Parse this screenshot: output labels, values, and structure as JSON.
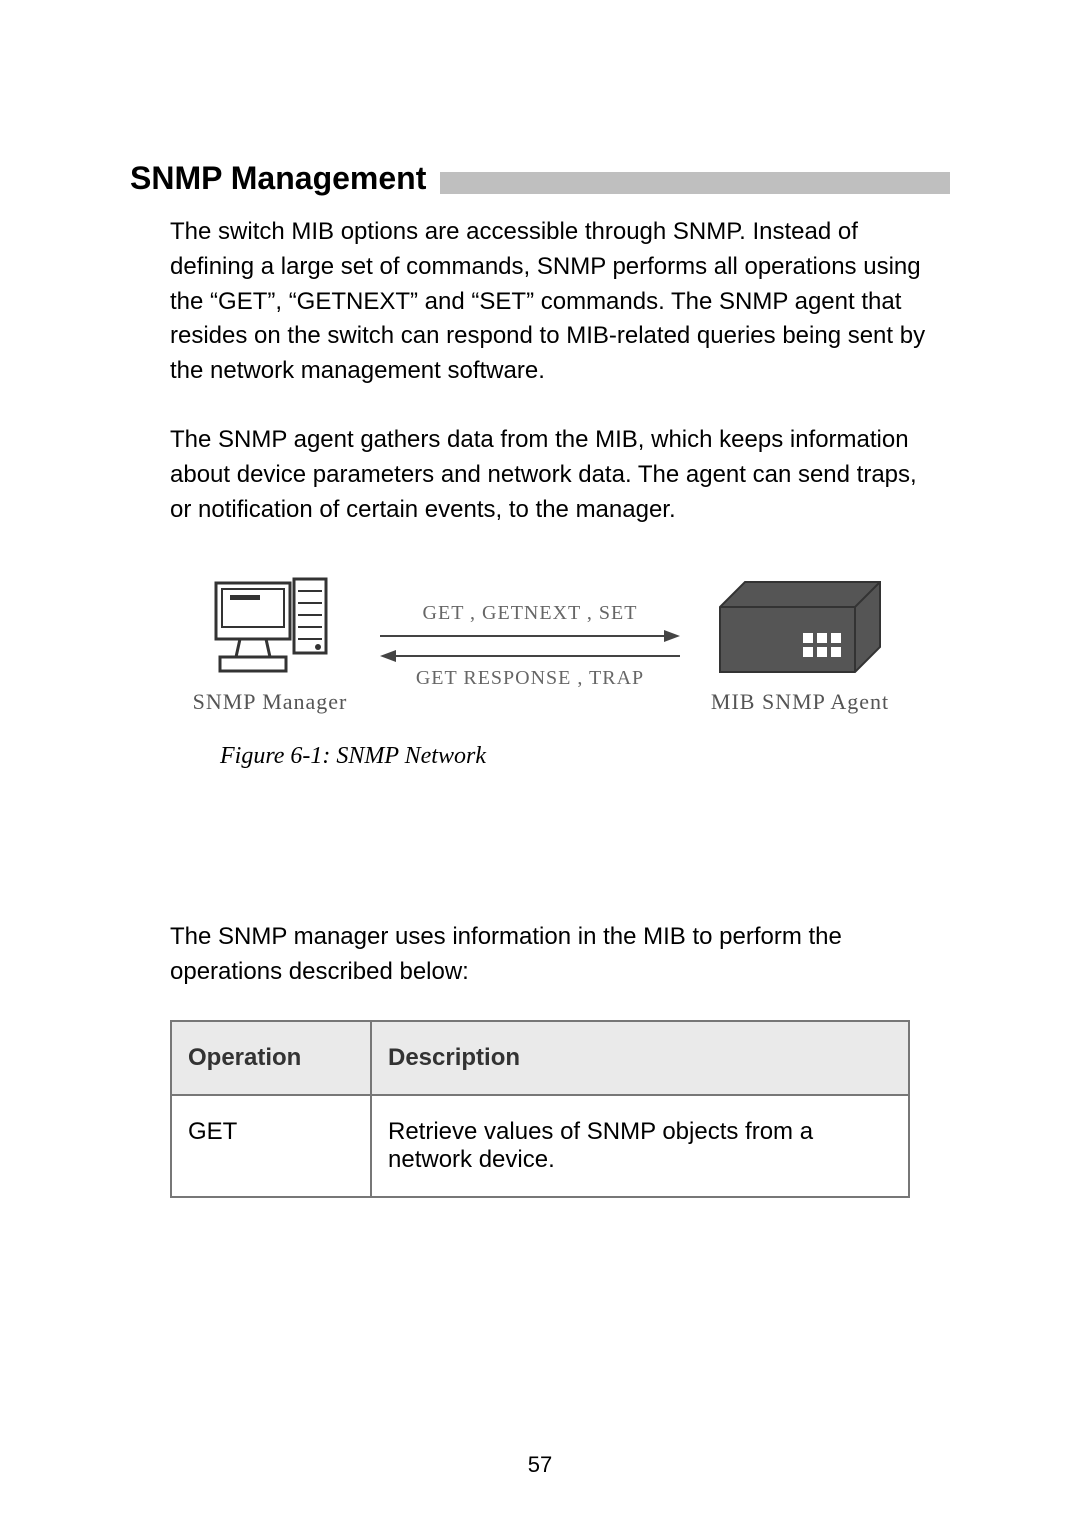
{
  "heading": "SNMP Management",
  "para1": "The switch MIB options are accessible through SNMP. Instead of defining a large set of commands, SNMP performs all operations using the “GET”, “GETNEXT” and “SET” commands. The SNMP agent that resides on the switch can respond to MIB-related queries being sent by the network management software.",
  "para2": "The SNMP agent gathers data from the MIB, which keeps information about device parameters and network data. The agent can send traps, or notification of certain events, to the manager.",
  "diagram": {
    "top_label": "GET , GETNEXT , SET",
    "bottom_label": "GET RESPONSE , TRAP",
    "left_label": "SNMP Manager",
    "right_label": "MIB SNMP Agent"
  },
  "caption": "Figure 6-1: SNMP Network",
  "para3": "The SNMP manager uses information in the MIB to perform the operations described below:",
  "table": {
    "headers": {
      "op": "Operation",
      "desc": "Description"
    },
    "rows": [
      {
        "op": "GET",
        "desc": "Retrieve values of SNMP objects from a network device."
      }
    ]
  },
  "page_number": "57"
}
